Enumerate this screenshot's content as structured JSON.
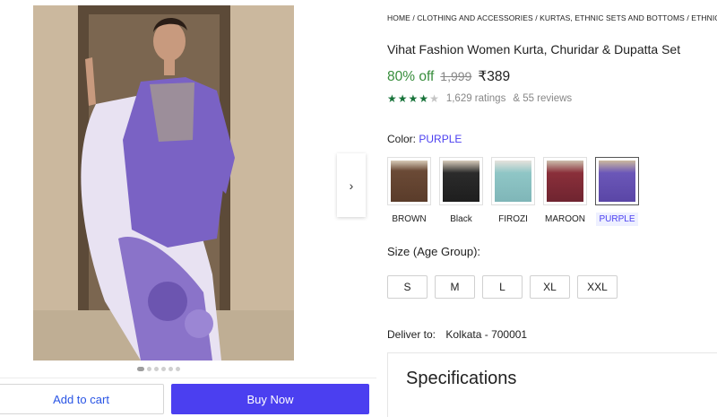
{
  "gallery": {
    "image_alt": "",
    "dots_count": 6,
    "active_dot": 0
  },
  "actions": {
    "add_to_cart": "Add to cart",
    "buy_now": "Buy Now"
  },
  "breadcrumb": "HOME / CLOTHING AND ACCESSORIES / KURTAS, ETHNIC SETS AND BOTTOMS / ETHNIC SETS",
  "product": {
    "title": "Vihat Fashion Women Kurta, Churidar & Dupatta Set",
    "discount": "80% off",
    "mrp": "1,999",
    "price": "₹389",
    "rating_stars": 4,
    "ratings": "1,629 ratings",
    "reviews": "& 55 reviews"
  },
  "color": {
    "label": "Color:",
    "selected": "PURPLE",
    "options": [
      {
        "name": "BROWN",
        "color": "#6b4a36"
      },
      {
        "name": "Black",
        "color": "#2b2b2b"
      },
      {
        "name": "FIROZI",
        "color": "#8fc6c6"
      },
      {
        "name": "MAROON",
        "color": "#8a2f3a"
      },
      {
        "name": "PURPLE",
        "color": "#6b57b8"
      }
    ]
  },
  "size": {
    "label": "Size (Age Group):",
    "options": [
      "S",
      "M",
      "L",
      "XL",
      "XXL"
    ]
  },
  "delivery": {
    "label": "Deliver to:",
    "location": "Kolkata - 700001"
  },
  "specifications": {
    "title": "Specifications"
  },
  "colors": {
    "accent": "#4b3ff0",
    "discount_green": "#388e3c",
    "star_green": "#18733a"
  }
}
